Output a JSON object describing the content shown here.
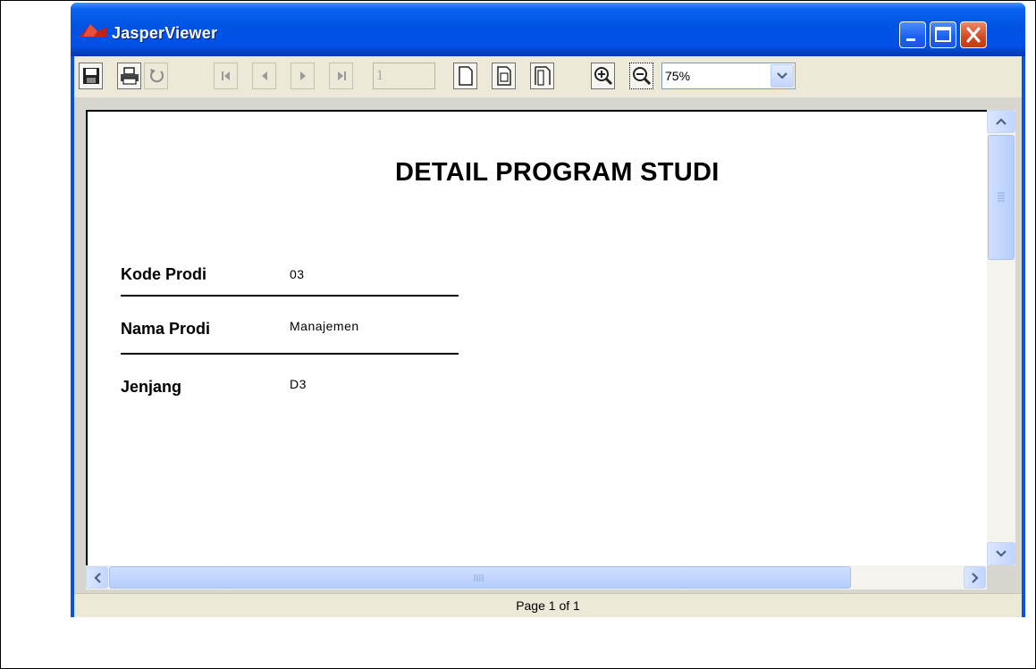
{
  "window": {
    "title": "JasperViewer"
  },
  "toolbar": {
    "page_number": "1",
    "zoom": "75%",
    "zoom_options_selected": "75%"
  },
  "report": {
    "title": "DETAIL PROGRAM STUDI",
    "fields": [
      {
        "label": "Kode Prodi",
        "value": "03"
      },
      {
        "label": "Nama Prodi",
        "value": "Manajemen"
      },
      {
        "label": "Jenjang",
        "value": "D3"
      }
    ]
  },
  "status": {
    "page_info": "Page 1 of 1"
  },
  "colors": {
    "titlebar": "#0054e3",
    "toolbar_bg": "#ece9d8",
    "close_button": "#d3491f"
  },
  "icons": [
    "jasper-logo-icon",
    "minimize-icon",
    "maximize-icon",
    "close-icon",
    "save-icon",
    "print-icon",
    "reload-icon",
    "first-page-icon",
    "previous-page-icon",
    "next-page-icon",
    "last-page-icon",
    "actual-size-icon",
    "fit-page-icon",
    "fit-width-icon",
    "zoom-in-icon",
    "zoom-out-icon",
    "chevron-down-icon"
  ]
}
